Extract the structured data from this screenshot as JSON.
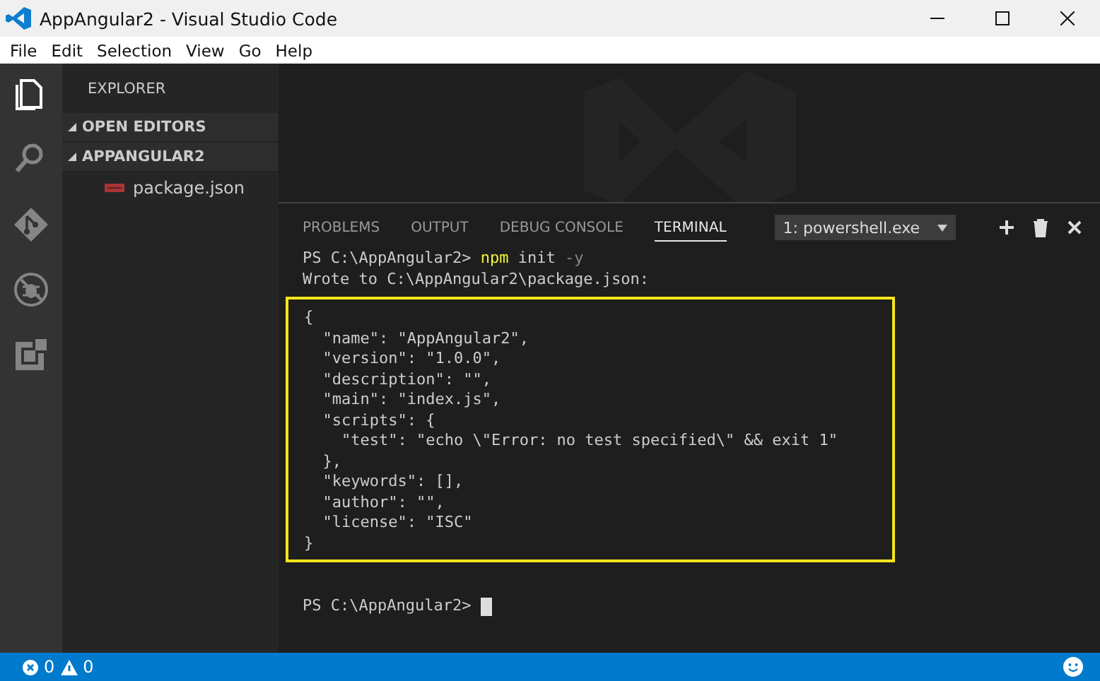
{
  "window": {
    "title": "AppAngular2 - Visual Studio Code"
  },
  "menu": [
    "File",
    "Edit",
    "Selection",
    "View",
    "Go",
    "Help"
  ],
  "activity_bar": [
    {
      "kind": "files",
      "selected": true
    },
    {
      "kind": "search",
      "selected": false
    },
    {
      "kind": "git",
      "selected": false
    },
    {
      "kind": "debug",
      "selected": false
    },
    {
      "kind": "extensions",
      "selected": false
    }
  ],
  "sidebar": {
    "title": "EXPLORER",
    "sections": [
      {
        "label": "OPEN EDITORS",
        "expanded": true
      },
      {
        "label": "APPANGULAR2",
        "expanded": true,
        "children": [
          {
            "label": "package.json"
          }
        ]
      }
    ]
  },
  "panel": {
    "tabs": [
      {
        "label": "PROBLEMS",
        "selected": false
      },
      {
        "label": "OUTPUT",
        "selected": false
      },
      {
        "label": "DEBUG CONSOLE",
        "selected": false
      },
      {
        "label": "TERMINAL",
        "selected": true
      }
    ],
    "terminal_select": "1: powershell.exe",
    "terminal": {
      "lines": [
        [
          {
            "kind": "plain",
            "text": "PS C:\\AppAngular2> "
          },
          {
            "kind": "command",
            "text": "npm"
          },
          {
            "kind": "plain",
            "text": " init "
          },
          {
            "kind": "flag",
            "text": "-y"
          }
        ],
        [
          {
            "kind": "plain",
            "text": "Wrote to C:\\AppAngular2\\package.json:"
          }
        ]
      ],
      "highlighted_output": [
        "{",
        "  \"name\": \"AppAngular2\",",
        "  \"version\": \"1.0.0\",",
        "  \"description\": \"\",",
        "  \"main\": \"index.js\",",
        "  \"scripts\": {",
        "    \"test\": \"echo \\\"Error: no test specified\\\" && exit 1\"",
        "  },",
        "  \"keywords\": [],",
        "  \"author\": \"\",",
        "  \"license\": \"ISC\"",
        "}"
      ],
      "prompt": "PS C:\\AppAngular2> "
    }
  },
  "status_bar": {
    "errors": "0",
    "warnings": "0"
  }
}
